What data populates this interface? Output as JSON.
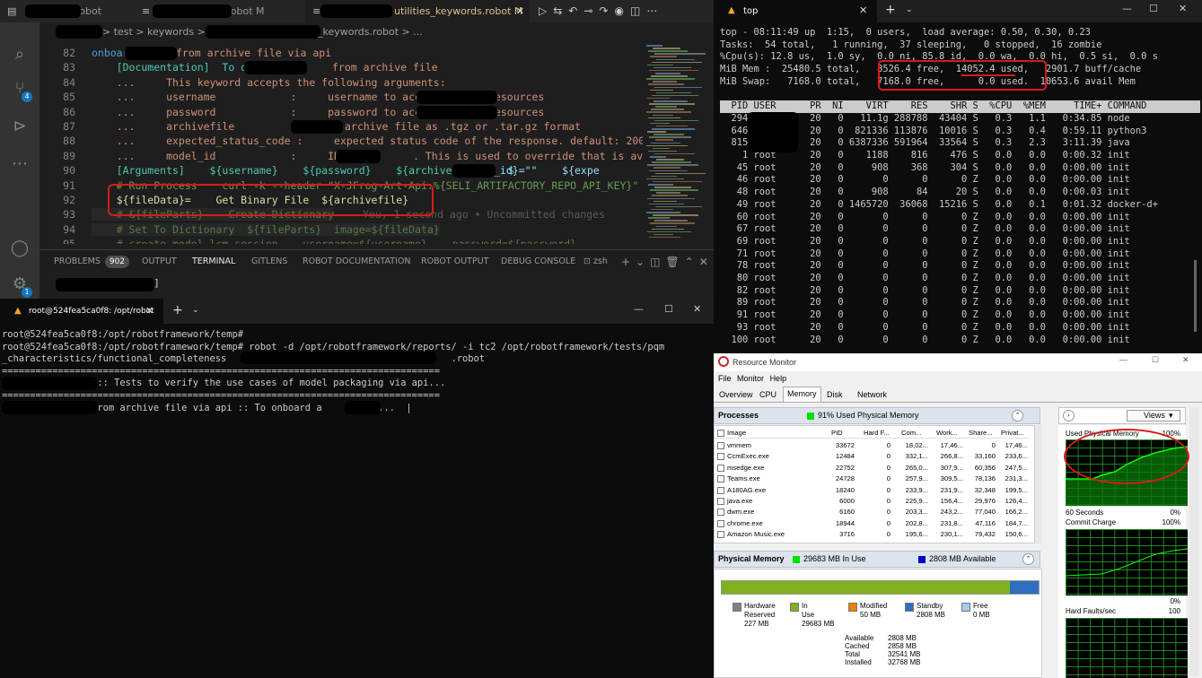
{
  "vscode": {
    "tabs": [
      {
        "label": "robot"
      },
      {
        "label": ".robot M"
      },
      {
        "label": "utilities_keywords.robot M"
      }
    ],
    "breadcrumb": "> test > keywords > ",
    "breadcrumb_end": "_keywords.robot > ...",
    "scm_badge": "4",
    "accounts_badge": "1",
    "code_lines": [
      {
        "num": "82",
        "text": "onboard"
      },
      {
        "num": "83",
        "text": "    [Documentation]  To onboard "
      },
      {
        "num": "84",
        "text": "    ...     This keyword accepts the following arguments:"
      },
      {
        "num": "85",
        "text": "    ...     username            :     username to access"
      },
      {
        "num": "86",
        "text": "    ...     password            :     password to access"
      },
      {
        "num": "87",
        "text": "    ...     archivefile         :"
      },
      {
        "num": "88",
        "text": "    ...     expected_status_code :     expected status code of the response. default: 200"
      },
      {
        "num": "89",
        "text": "    ...     model_id            :     ID of th"
      },
      {
        "num": "90",
        "text": "    [Arguments]    ${username}    ${password}    ${archivefile}    $"
      },
      {
        "num": "91",
        "text": "    # Run Process    curl -k --header \"X-JFrog-Art-Api:%{SELI_ARTIFACTORY_REPO_API_KEY}\" --"
      },
      {
        "num": "92",
        "text": "    ${fileData}=    Get Binary File  ${archivefile}"
      },
      {
        "num": "93",
        "text": "    # &{fileParts}    Create Dictionary"
      },
      {
        "num": "94",
        "text": "    # Set To Dictionary  ${fileParts}  image=${fileData}"
      },
      {
        "num": "95",
        "text": "    # create model lcm session    username=${username}    password=${password}"
      }
    ],
    "code_fragments": {
      "l82_tail": "from archive file via api",
      "l83_tail": "from archive file",
      "l85_tail": "resources",
      "l86_tail": "resources",
      "l87_tail": "archive file as .tgz or .tar.gz format",
      "l89_tail": ". This is used to override that is avai",
      "l90_tail": "_id}=\"\"    ${expe",
      "blame": "You, 1 second ago • Uncommitted changes"
    },
    "panel_tabs": [
      "PROBLEMS",
      "OUTPUT",
      "TERMINAL",
      "GITLENS",
      "ROBOT DOCUMENTATION",
      "ROBOT OUTPUT",
      "DEBUG CONSOLE"
    ],
    "problems_count": "902",
    "shell_label": "zsh",
    "active_panel_tab": "TERMINAL"
  },
  "bottom_terminal": {
    "title": "root@524fea5ca0f8: /opt/robot",
    "lines": [
      "root@524fea5ca0f8:/opt/robotframework/temp#",
      "root@524fea5ca0f8:/opt/robotframework/temp# robot -d /opt/robotframework/reports/ -i tc2 /opt/robotframework/tests/pqm",
      "_characteristics/functional_completeness                                        .robot",
      "==============================================================================",
      "                 :: Tests to verify the use cases of model packaging via api...",
      "==============================================================================",
      "                from archive file via api :: To onboard a      . fr...  |"
    ]
  },
  "top_terminal": {
    "title": "top",
    "summary": [
      "top - 08:11:49 up  1:15,  0 users,  load average: 0.50, 0.30, 0.23",
      "Tasks:  54 total,   1 running,  37 sleeping,   0 stopped,  16 zombie",
      "%Cpu(s): 12.8 us,  1.0 sy,  0.0 ni, 85.8 id,  0.0 wa,  0.0 hi,  0.5 si,  0.0 s",
      "MiB Mem :  25480.5 total,   8526.4 free,  14052.4 used,   2901.7 buff/cache",
      "MiB Swap:   7168.0 total,   7168.0 free,      0.0 used.  10653.6 avail Mem"
    ],
    "header": "  PID USER      PR  NI    VIRT    RES    SHR S  %CPU  %MEM     TIME+ COMMAND    ",
    "rows": [
      "  294           20   0   11.1g 288788  43404 S   0.3   1.1   0:34.85 node",
      "  646           20   0  821336 113876  10016 S   0.3   0.4   0:59.11 python3",
      "  815           20   0 6387336 591964  33564 S   0.3   2.3   3:11.39 java",
      "    1 root      20   0    1188    816    476 S   0.0   0.0   0:00.32 init",
      "   45 root      20   0     908    368    304 S   0.0   0.0   0:00.00 init",
      "   46 root      20   0       0      0      0 Z   0.0   0.0   0:00.00 init",
      "   48 root      20   0     908     84     20 S   0.0   0.0   0:00.03 init",
      "   49 root      20   0 1465720  36068  15216 S   0.0   0.1   0:01.32 docker-d+",
      "   60 root      20   0       0      0      0 Z   0.0   0.0   0:00.00 init",
      "   67 root      20   0       0      0      0 Z   0.0   0.0   0:00.00 init",
      "   69 root      20   0       0      0      0 Z   0.0   0.0   0:00.00 init",
      "   71 root      20   0       0      0      0 Z   0.0   0.0   0:00.00 init",
      "   78 root      20   0       0      0      0 Z   0.0   0.0   0:00.00 init",
      "   80 root      20   0       0      0      0 Z   0.0   0.0   0:00.00 init",
      "   82 root      20   0       0      0      0 Z   0.0   0.0   0:00.00 init",
      "   89 root      20   0       0      0      0 Z   0.0   0.0   0:00.00 init",
      "   91 root      20   0       0      0      0 Z   0.0   0.0   0:00.00 init",
      "   93 root      20   0       0      0      0 Z   0.0   0.0   0:00.00 init",
      "  100 root      20   0       0      0      0 Z   0.0   0.0   0:00.00 init"
    ]
  },
  "resource_monitor": {
    "title": "Resource Monitor",
    "menu": [
      "File",
      "Monitor",
      "Help"
    ],
    "tabs": [
      "Overview",
      "CPU",
      "Memory",
      "Disk",
      "Network"
    ],
    "active_tab": "Memory",
    "processes_label": "Processes",
    "used_physical": "91% Used Physical Memory",
    "columns": [
      "Image",
      "PID",
      "Hard F...",
      "Com...",
      "Work...",
      "Share...",
      "Privat..."
    ],
    "processes": [
      [
        "vmmem",
        "33672",
        "0",
        "18,02...",
        "17,46...",
        "0",
        "17,46..."
      ],
      [
        "CcmExec.exe",
        "12484",
        "0",
        "332,1...",
        "266,8...",
        "33,160",
        "233,6..."
      ],
      [
        "msedge.exe",
        "22752",
        "0",
        "265,0...",
        "307,9...",
        "60,356",
        "247,5..."
      ],
      [
        "Teams.exe",
        "24728",
        "0",
        "257,9...",
        "309,5...",
        "78,136",
        "231,3..."
      ],
      [
        "A180AG.exe",
        "18240",
        "0",
        "233,9...",
        "231,9...",
        "32,348",
        "199,5..."
      ],
      [
        "java.exe",
        "6000",
        "0",
        "225,9...",
        "156,4...",
        "29,976",
        "126,4..."
      ],
      [
        "dwm.exe",
        "6160",
        "0",
        "203,3...",
        "243,2...",
        "77,040",
        "166,2..."
      ],
      [
        "chrome.exe",
        "18944",
        "0",
        "202,8...",
        "231,8...",
        "47,116",
        "184,7..."
      ],
      [
        "Amazon Music.exe",
        "3716",
        "0",
        "195,6...",
        "230,1...",
        "79,432",
        "150,6..."
      ]
    ],
    "physical_label": "Physical Memory",
    "in_use_label": "29683 MB In Use",
    "available_label": "2808 MB Available",
    "legend": [
      {
        "name": "Hardware Reserved",
        "value": "227 MB",
        "color": "#808080"
      },
      {
        "name": "In Use",
        "value": "29683 MB",
        "color": "#7fb01f"
      },
      {
        "name": "Modified",
        "value": "50 MB",
        "color": "#e8820c"
      },
      {
        "name": "Standby",
        "value": "2808 MB",
        "color": "#2f6fbf"
      },
      {
        "name": "Free",
        "value": "0 MB",
        "color": "#a8c8ee"
      }
    ],
    "stats": [
      {
        "name": "Available",
        "value": "2808 MB"
      },
      {
        "name": "Cached",
        "value": "2858 MB"
      },
      {
        "name": "Total",
        "value": "32541 MB"
      },
      {
        "name": "Installed",
        "value": "32768 MB"
      }
    ],
    "views_label": "Views",
    "graphs": {
      "g1_title": "Used Physical Memory",
      "g1_max": "100%",
      "g1_time": "60 Seconds",
      "g1_min": "0%",
      "g2_title": "Commit Charge",
      "g2_max": "100%",
      "g2_min": "0%",
      "g3_title": "Hard Faults/sec",
      "g3_max": "100"
    },
    "memory_bar": {
      "in_use_fraction": 0.91
    }
  },
  "colors": {
    "accent": "#007acc",
    "highlight_red": "#d81b1b",
    "rm_green": "#00ff00"
  }
}
